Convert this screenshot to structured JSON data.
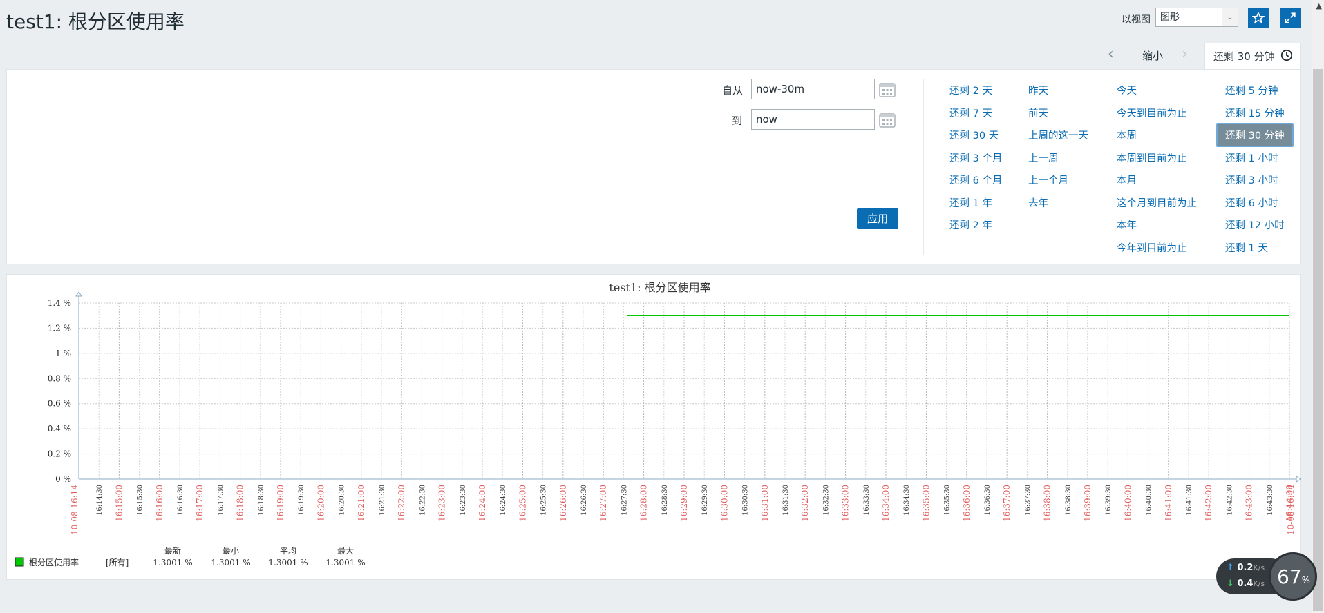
{
  "header": {
    "title": "test1: 根分区使用率",
    "view_as_label": "以视图",
    "view_select_value": "图形"
  },
  "time_tabs": {
    "zoom_out": "缩小",
    "active_tab": "还剩 30 分钟"
  },
  "filter": {
    "from_label": "自从",
    "from_value": "now-30m",
    "to_label": "到",
    "to_value": "now",
    "apply_label": "应用",
    "quick_ranges": [
      [
        "还剩 2 天",
        "还剩 7 天",
        "还剩 30 天",
        "还剩 3 个月",
        "还剩 6 个月",
        "还剩 1 年",
        "还剩 2 年"
      ],
      [
        "昨天",
        "前天",
        "上周的这一天",
        "上一周",
        "上一个月",
        "去年"
      ],
      [
        "今天",
        "今天到目前为止",
        "本周",
        "本周到目前为止",
        "本月",
        "这个月到目前为止",
        "本年",
        "今年到目前为止"
      ],
      [
        "还剩 5 分钟",
        "还剩 15 分钟",
        "还剩 30 分钟",
        "还剩 1 小时",
        "还剩 3 小时",
        "还剩 6 小时",
        "还剩 12 小时",
        "还剩 1 天"
      ]
    ],
    "selected_range": "还剩 30 分钟"
  },
  "chart_data": {
    "type": "line",
    "title": "test1: 根分区使用率",
    "yticks": [
      "0 %",
      "0.2 %",
      "0.4 %",
      "0.6 %",
      "0.8 %",
      "1 %",
      "1.2 %",
      "1.4 %"
    ],
    "ylim": [
      0,
      1.4
    ],
    "xlim": [
      "16:14",
      "16:44"
    ],
    "xticks": [
      "16:14:30",
      "16:15:00",
      "16:15:30",
      "16:16:00",
      "16:16:30",
      "16:17:00",
      "16:17:30",
      "16:18:00",
      "16:18:30",
      "16:19:00",
      "16:19:30",
      "16:20:00",
      "16:20:30",
      "16:21:00",
      "16:21:30",
      "16:22:00",
      "16:22:30",
      "16:23:00",
      "16:23:30",
      "16:24:00",
      "16:24:30",
      "16:25:00",
      "16:25:30",
      "16:26:00",
      "16:26:30",
      "16:27:00",
      "16:27:30",
      "16:28:00",
      "16:28:30",
      "16:29:00",
      "16:29:30",
      "16:30:00",
      "16:30:30",
      "16:31:00",
      "16:31:30",
      "16:32:00",
      "16:32:30",
      "16:33:00",
      "16:33:30",
      "16:34:00",
      "16:34:30",
      "16:35:00",
      "16:35:30",
      "16:36:00",
      "16:36:30",
      "16:37:00",
      "16:37:30",
      "16:38:00",
      "16:38:30",
      "16:39:00",
      "16:39:30",
      "16:40:00",
      "16:40:30",
      "16:41:00",
      "16:41:30",
      "16:42:00",
      "16:42:30",
      "16:43:00",
      "16:43:30",
      "16:44:00"
    ],
    "x_start_label": "10-08 16:14",
    "x_end_label": "10-08 16:44",
    "grid": true,
    "series": [
      {
        "name": "根分区使用率",
        "color": "#00c800",
        "x": [
          "16:27:35",
          "16:44:00"
        ],
        "values": [
          1.3001,
          1.3001
        ]
      }
    ],
    "legend": {
      "headers": [
        "最新",
        "最小",
        "平均",
        "最大"
      ],
      "rows": [
        {
          "name": "根分区使用率",
          "func": "[所有]",
          "latest": "1.3001 %",
          "min": "1.3001 %",
          "avg": "1.3001 %",
          "max": "1.3001 %"
        }
      ]
    }
  },
  "network_widget": {
    "upload": "0.2",
    "download": "0.4",
    "unit": "K/s",
    "percent": "67",
    "percent_unit": "%"
  }
}
